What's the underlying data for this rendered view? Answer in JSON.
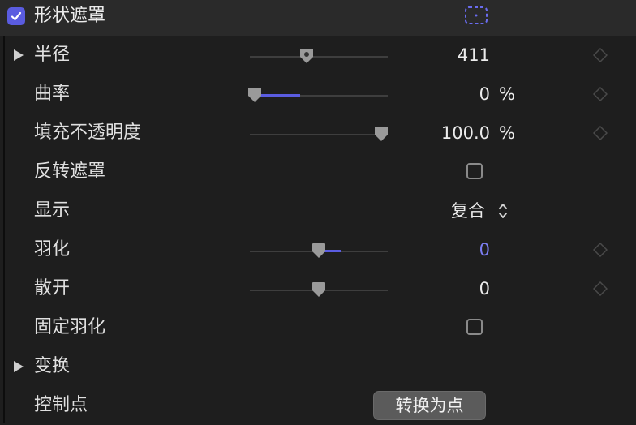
{
  "header": {
    "enabled": true,
    "title": "形状遮罩",
    "icon": "shape-mask-icon"
  },
  "accent_color": "#5a5ce0",
  "rows": {
    "radius": {
      "label": "半径",
      "value": "411",
      "slider_fraction": 0.41
    },
    "curvature": {
      "label": "曲率",
      "value": "0",
      "unit": "%",
      "slider_fraction": 0.0
    },
    "fill_opacity": {
      "label": "填充不透明度",
      "value": "100.0",
      "unit": "%",
      "slider_fraction": 1.0
    },
    "invert_mask": {
      "label": "反转遮罩",
      "checked": false
    },
    "display": {
      "label": "显示",
      "value": "复合"
    },
    "feather": {
      "label": "羽化",
      "value": "0",
      "slider_fraction": 0.5
    },
    "falloff": {
      "label": "散开",
      "value": "0",
      "slider_fraction": 0.5
    },
    "fixed_feather": {
      "label": "固定羽化",
      "checked": false
    },
    "transform": {
      "label": "变换"
    },
    "control_points": {
      "label": "控制点",
      "button_label": "转换为点"
    }
  }
}
